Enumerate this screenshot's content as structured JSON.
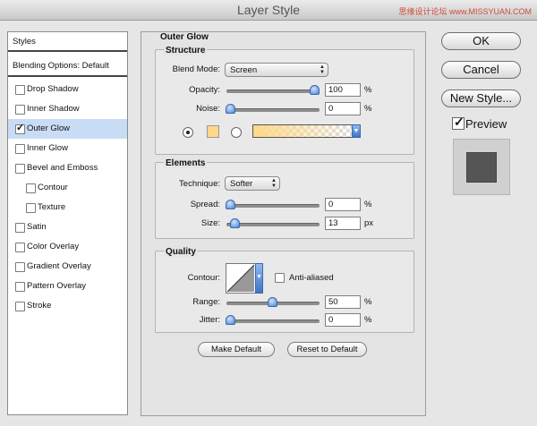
{
  "window": {
    "title": "Layer Style",
    "watermark": "思缘设计论坛  www.MISSYUAN.COM"
  },
  "styles_list": {
    "header": "Styles",
    "blending": "Blending Options: Default",
    "items": [
      {
        "label": "Drop Shadow",
        "checked": false,
        "indent": false
      },
      {
        "label": "Inner Shadow",
        "checked": false,
        "indent": false
      },
      {
        "label": "Outer Glow",
        "checked": true,
        "indent": false,
        "selected": true
      },
      {
        "label": "Inner Glow",
        "checked": false,
        "indent": false
      },
      {
        "label": "Bevel and Emboss",
        "checked": false,
        "indent": false
      },
      {
        "label": "Contour",
        "checked": false,
        "indent": true
      },
      {
        "label": "Texture",
        "checked": false,
        "indent": true
      },
      {
        "label": "Satin",
        "checked": false,
        "indent": false
      },
      {
        "label": "Color Overlay",
        "checked": false,
        "indent": false
      },
      {
        "label": "Gradient Overlay",
        "checked": false,
        "indent": false
      },
      {
        "label": "Pattern Overlay",
        "checked": false,
        "indent": false
      },
      {
        "label": "Stroke",
        "checked": false,
        "indent": false
      }
    ]
  },
  "outer_glow": {
    "title": "Outer Glow",
    "structure": {
      "title": "Structure",
      "blend_mode_label": "Blend Mode:",
      "blend_mode_value": "Screen",
      "opacity_label": "Opacity:",
      "opacity_value": "100",
      "opacity_unit": "%",
      "opacity_level": 1.0,
      "noise_label": "Noise:",
      "noise_value": "0",
      "noise_unit": "%",
      "noise_level": 0.0,
      "glow_color": "#ffd88a"
    },
    "elements": {
      "title": "Elements",
      "technique_label": "Technique:",
      "technique_value": "Softer",
      "spread_label": "Spread:",
      "spread_value": "0",
      "spread_unit": "%",
      "spread_level": 0.0,
      "size_label": "Size:",
      "size_value": "13",
      "size_unit": "px",
      "size_level": 0.052
    },
    "quality": {
      "title": "Quality",
      "contour_label": "Contour:",
      "antialiased_label": "Anti-aliased",
      "antialiased_checked": false,
      "range_label": "Range:",
      "range_value": "50",
      "range_unit": "%",
      "range_level": 0.5,
      "jitter_label": "Jitter:",
      "jitter_value": "0",
      "jitter_unit": "%",
      "jitter_level": 0.0
    },
    "make_default": "Make Default",
    "reset_default": "Reset to Default"
  },
  "actions": {
    "ok": "OK",
    "cancel": "Cancel",
    "new_style": "New Style...",
    "preview_label": "Preview",
    "preview_checked": true
  }
}
